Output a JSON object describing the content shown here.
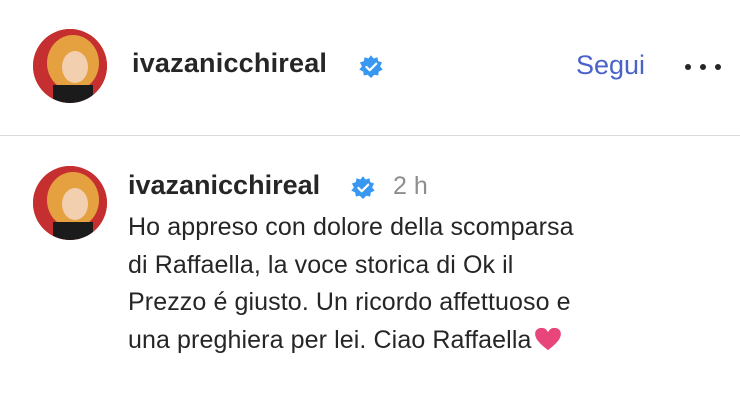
{
  "header": {
    "username": "ivazanicchireal",
    "follow_label": "Segui",
    "more_icon": "more-horizontal-icon"
  },
  "comment": {
    "username": "ivazanicchireal",
    "time": "2 h",
    "lines": [
      "Ho appreso con dolore della scomparsa",
      "di Raffaella, la voce storica di Ok il",
      "Prezzo é giusto. Un ricordo affettuoso e",
      "una preghiera per lei. Ciao Raffaella"
    ],
    "emoji": "heart-emoji"
  },
  "colors": {
    "follow": "#4a63c9",
    "verified": "#3897f0",
    "heart": "#e8457a",
    "muted": "#8e8e8e"
  }
}
